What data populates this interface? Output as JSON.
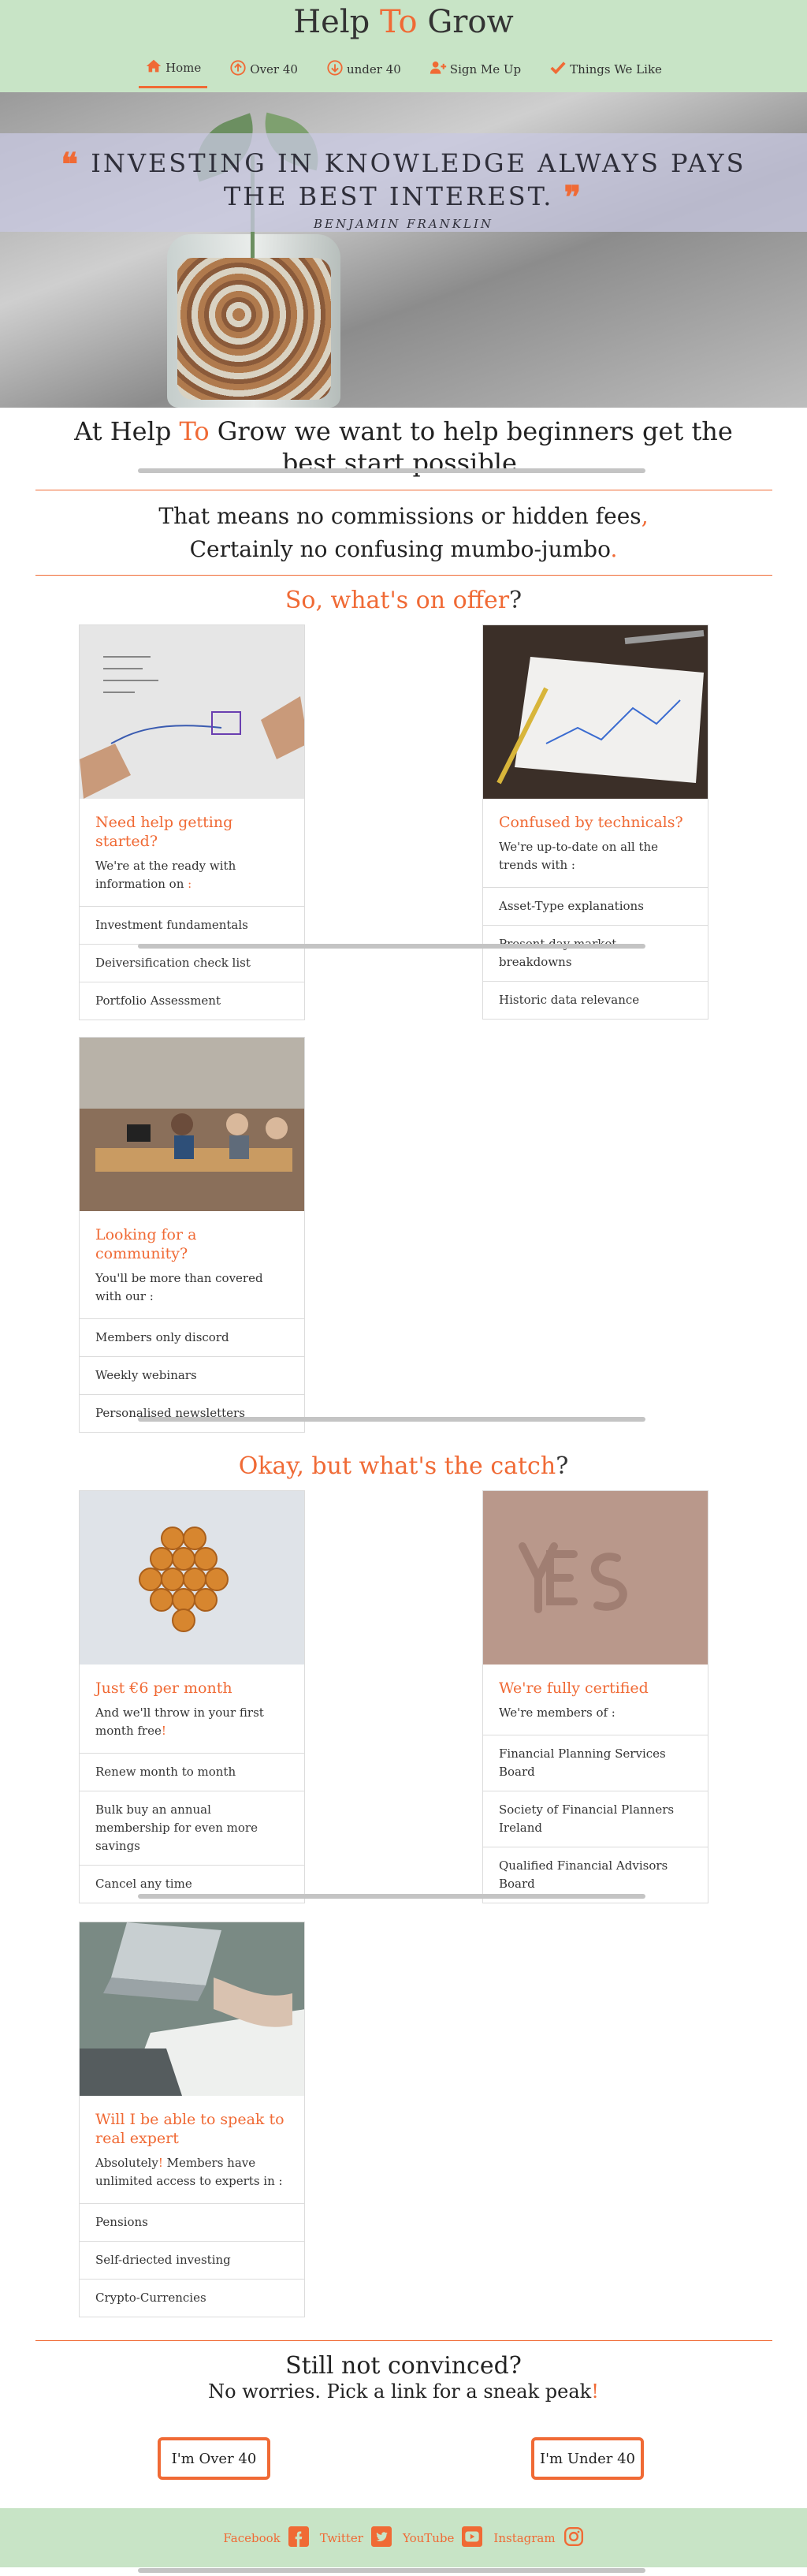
{
  "brand": {
    "part1": "Help ",
    "part2": "To",
    "part3": " Grow"
  },
  "nav": [
    {
      "label": "Home",
      "icon": "home-icon",
      "active": true
    },
    {
      "label": "Over 40",
      "icon": "arrow-up-circle-icon"
    },
    {
      "label": "under 40",
      "icon": "arrow-down-circle-icon"
    },
    {
      "label": "Sign Me Up",
      "icon": "user-plus-icon"
    },
    {
      "label": "Things We Like",
      "icon": "check-icon"
    }
  ],
  "hero": {
    "quote": "INVESTING IN KNOWLEDGE ALWAYS PAYS THE BEST INTEREST.",
    "author": "BENJAMIN FRANKLIN"
  },
  "intro": {
    "part1": "At Help ",
    "part2": "To",
    "part3": " Grow we want to help beginners get the best start possible",
    "dot": "."
  },
  "sub": {
    "line1": "That means no commissions or hidden fees",
    "comma": ",",
    "line2": "Certainly no confusing mumbo-jumbo",
    "dot": "."
  },
  "offer_title": {
    "text": "So, what's on offer",
    "q": "?"
  },
  "offer_cards": [
    {
      "title": "Need help getting started?",
      "text": "We're at the ready with information on",
      "colon": " :",
      "items": [
        "Investment fundamentals",
        "Deiversification check list",
        "Portfolio Assessment"
      ]
    },
    {
      "title": "Confused by technicals?",
      "text": "We're up-to-date on all the trends with :",
      "items": [
        "Asset-Type explanations",
        "Present day market breakdowns",
        "Historic data relevance"
      ]
    },
    {
      "title": "Looking for a community?",
      "text": "You'll be more than covered with our :",
      "items": [
        "Members only discord",
        "Weekly webinars",
        "Personalised newsletters"
      ]
    }
  ],
  "catch_title": {
    "text": "Okay, but what's the catch",
    "q": "?"
  },
  "catch_cards": [
    {
      "title": "Just €6 per month",
      "text": "And we'll throw in your first month free",
      "excl": "!",
      "items": [
        "Renew month to month",
        "Bulk buy an annual membership for even more savings",
        "Cancel any time"
      ]
    },
    {
      "title": "We're fully certified",
      "text": "We're members of :",
      "items": [
        "Financial Planning Services Board",
        "Society of Financial Planners Ireland",
        "Qualified Financial Advisors Board"
      ]
    },
    {
      "title": "Will I be able to speak to real expert",
      "text_a": "Absolutely",
      "excl": "!",
      "text_b": " Members have unlimited access to experts in :",
      "items": [
        "Pensions",
        "Self-driected investing",
        "Crypto-Currencies"
      ]
    }
  ],
  "cta": {
    "title": "Still not convinced?",
    "sub": "No worries. Pick a link for a sneak peak",
    "excl": "!",
    "btn_over": "I'm Over 40",
    "btn_under": "I'm Under 40"
  },
  "footer": [
    {
      "label": "Facebook",
      "icon": "facebook-icon"
    },
    {
      "label": "Twitter",
      "icon": "twitter-icon"
    },
    {
      "label": "YouTube",
      "icon": "youtube-icon"
    },
    {
      "label": "Instagram",
      "icon": "instagram-icon"
    }
  ],
  "colors": {
    "accent": "#f06a35",
    "header_bg": "#c8e4c6"
  }
}
